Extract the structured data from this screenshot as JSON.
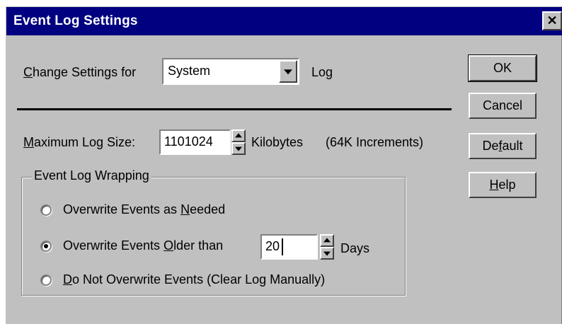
{
  "dialog": {
    "title": "Event Log Settings",
    "close_glyph": "✕"
  },
  "settings_for": {
    "label_accel": "C",
    "label_rest": "hange Settings for",
    "selected": "System",
    "suffix": "Log"
  },
  "max_size": {
    "label_accel": "M",
    "label_rest": "aximum Log Size:",
    "value": "1101024",
    "unit": "Kilobytes",
    "note": "(64K Increments)"
  },
  "wrapping": {
    "group_title": "Event Log Wrapping",
    "options": [
      {
        "pre": "Overwrite Events as ",
        "accel": "N",
        "post": "eeded",
        "selected": false
      },
      {
        "pre": "Overwrite Events ",
        "accel": "O",
        "post": "lder than",
        "selected": true
      },
      {
        "pre": "",
        "accel": "D",
        "post": "o Not Overwrite Events (Clear Log Manually)",
        "selected": false
      }
    ],
    "days_value": "20",
    "days_unit": "Days"
  },
  "buttons": {
    "ok": "OK",
    "cancel": "Cancel",
    "default_pre": "De",
    "default_accel": "f",
    "default_post": "ault",
    "help_accel": "H",
    "help_post": "elp"
  }
}
